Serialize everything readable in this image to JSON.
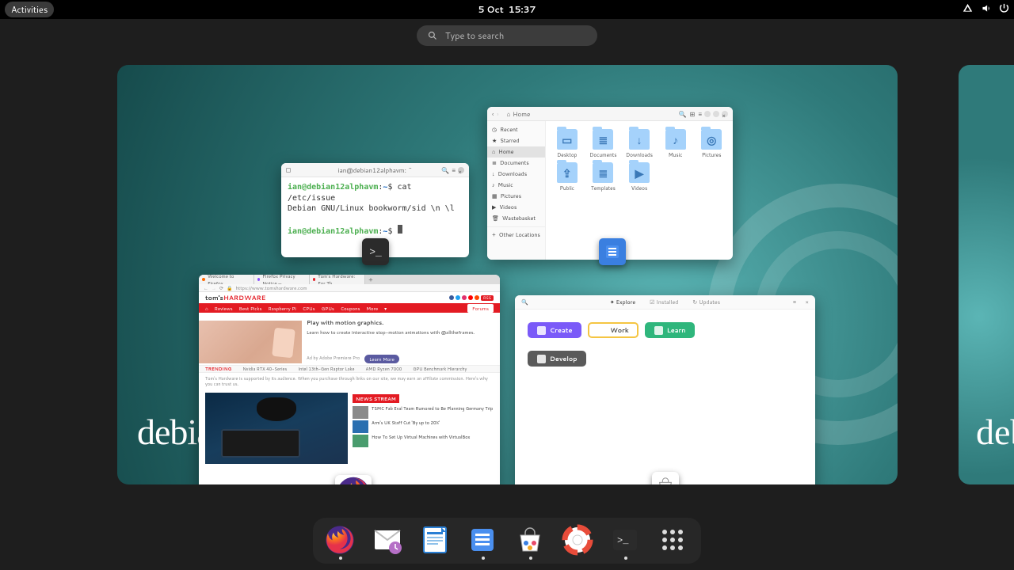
{
  "topbar": {
    "activities": "Activities",
    "date": "5 Oct",
    "time": "15:37"
  },
  "search": {
    "placeholder": "Type to search"
  },
  "workspace": {
    "brand": "debian",
    "brand_edge": "deb"
  },
  "terminal": {
    "title": "ian@debian12alphavm: ~",
    "user": "ian@debian12alphavm",
    "sep": ":",
    "path": "~",
    "prompt": "$ ",
    "cmd": "cat /etc/issue",
    "out": "Debian GNU/Linux bookworm/sid \\n \\l"
  },
  "files": {
    "pathbar": "Home",
    "sidebar": [
      "Recent",
      "Starred",
      "Home",
      "Documents",
      "Downloads",
      "Music",
      "Pictures",
      "Videos",
      "Wastebasket",
      "Other Locations"
    ],
    "sidebar_active": 2,
    "items": [
      {
        "name": "Desktop",
        "sym": "▭"
      },
      {
        "name": "Documents",
        "sym": "≣"
      },
      {
        "name": "Downloads",
        "sym": "↓"
      },
      {
        "name": "Music",
        "sym": "♪"
      },
      {
        "name": "Pictures",
        "sym": "◎"
      },
      {
        "name": "Public",
        "sym": "⇪"
      },
      {
        "name": "Templates",
        "sym": "≣"
      },
      {
        "name": "Videos",
        "sym": "▶"
      }
    ]
  },
  "browser": {
    "tabs": [
      "Welcome to Firefox",
      "Firefox Privacy Notice —",
      "Tom's Hardware: For Th…"
    ],
    "url": "https://www.tomshardware.com",
    "logo_a": "tom's",
    "logo_b": "HARDWARE",
    "nav": [
      "Reviews",
      "Best Picks",
      "Raspberry Pi",
      "CPUs",
      "GPUs",
      "Coupons",
      "More"
    ],
    "nav_forums": "Forums",
    "hero_title": "Play with motion graphics.",
    "hero_sub": "Learn how to create interactive stop-motion animations with @alltheframes.",
    "hero_ad": "Ad by Adobe Premiere Pro",
    "hero_btn": "Learn More",
    "ticker_label": "TRENDING",
    "ticker": [
      "Nvidia RTX 40-Series",
      "Intel 13th-Gen Raptor Lake",
      "AMD Ryzen 7000",
      "GPU Benchmark Hierarchy"
    ],
    "disclaimer": "Tom's Hardware is supported by its audience. When you purchase through links on our site, we may earn an affiliate commission. Here's why you can trust us.",
    "news_label": "NEWS STREAM",
    "news": [
      "TSMC Fab Eval Team Rumored to Be Planning Germany Trip",
      "Arm's UK Staff Cut 'By up to 20%'",
      "How To Set Up Virtual Machines with VirtualBox"
    ]
  },
  "software": {
    "tabs": [
      "Explore",
      "Installed",
      "Updates"
    ],
    "pills": [
      {
        "name": "Create",
        "bg": "#7a5af8"
      },
      {
        "name": "Work",
        "bg": "#ffffff",
        "fg": "#444",
        "border": "#f5c542"
      },
      {
        "name": "Learn",
        "bg": "#2fb67c"
      },
      {
        "name": "Develop",
        "bg": "#5a5a5a"
      }
    ]
  },
  "dash": {
    "apps": [
      {
        "name": "firefox",
        "running": true
      },
      {
        "name": "evolution-mail",
        "running": false
      },
      {
        "name": "libreoffice-writer",
        "running": false
      },
      {
        "name": "files",
        "running": true
      },
      {
        "name": "software",
        "running": true
      },
      {
        "name": "help",
        "running": false
      },
      {
        "name": "terminal",
        "running": true
      },
      {
        "name": "show-apps",
        "running": false
      }
    ]
  }
}
